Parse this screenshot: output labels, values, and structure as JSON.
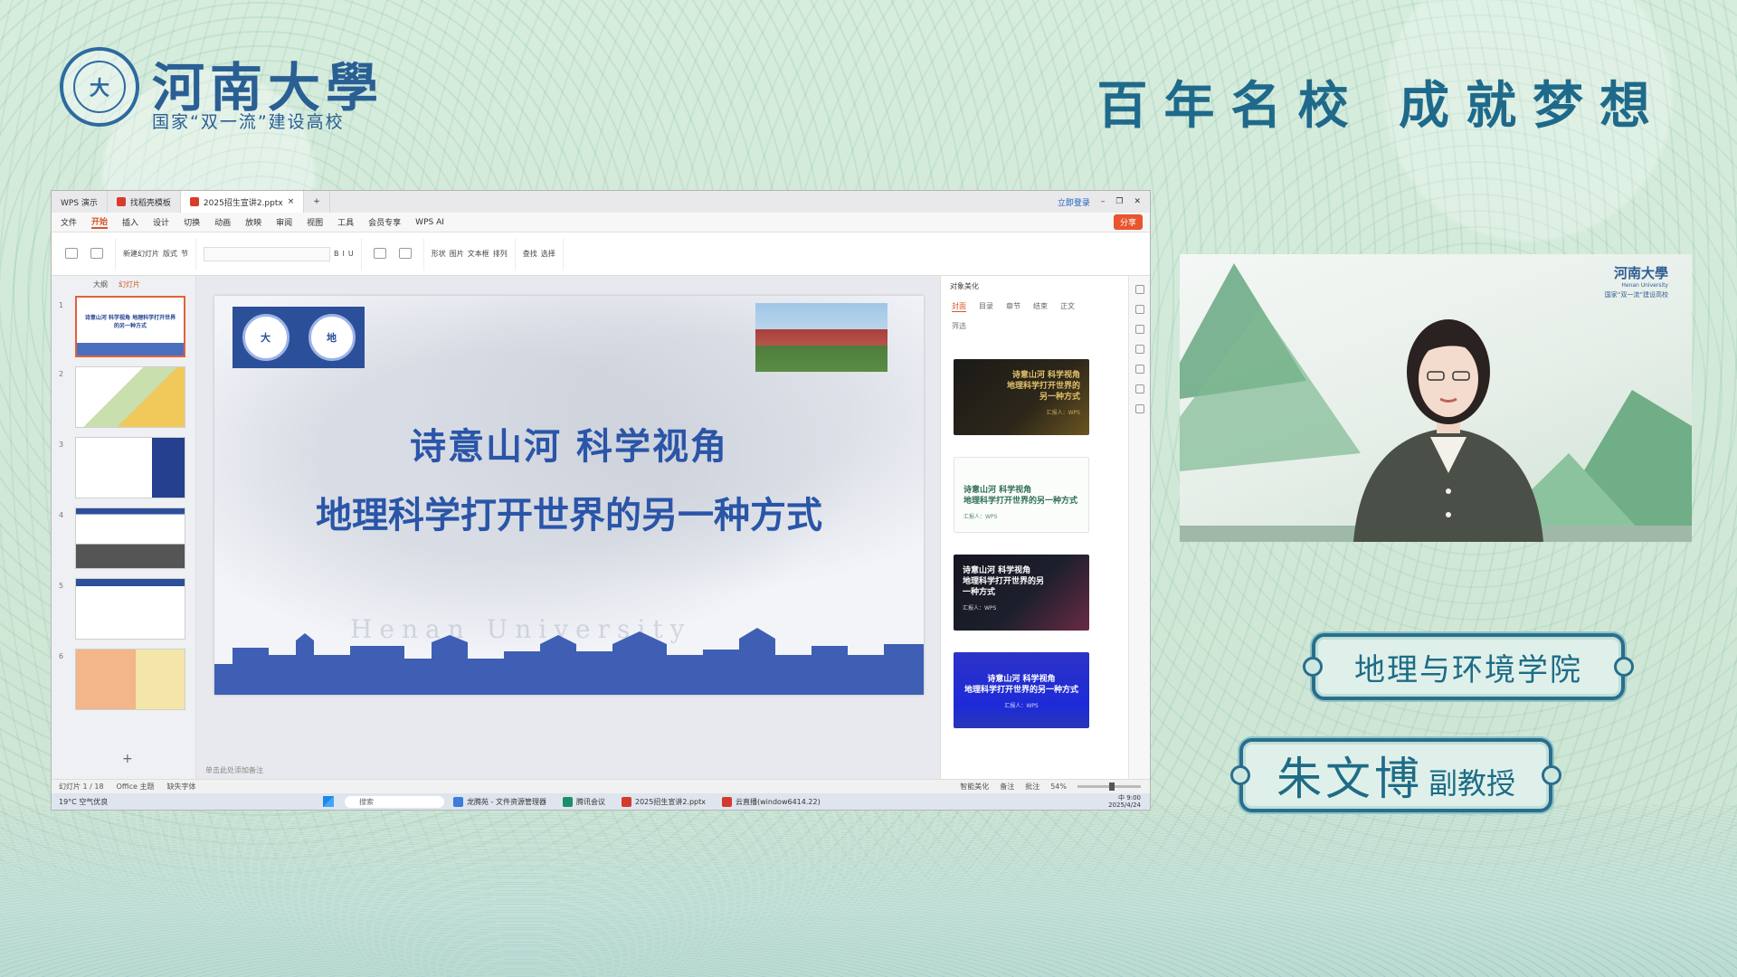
{
  "header": {
    "logo_text": "大",
    "university_name": "河南大學",
    "university_subtitle": "国家“双一流”建设高校",
    "motto": "百年名校 成就梦想"
  },
  "app": {
    "tabs": [
      "WPS 演示",
      "找稻壳模板",
      "2025招生宣讲2.pptx"
    ],
    "login": "立即登录",
    "menu": [
      "文件",
      "开始",
      "插入",
      "设计",
      "切换",
      "动画",
      "放映",
      "审阅",
      "视图",
      "工具",
      "会员专享",
      "WPS AI"
    ],
    "active_menu": "开始",
    "share": "分享",
    "ribbon": {
      "new_slide": "新建幻灯片",
      "layout": "版式",
      "section": "节",
      "find": "查找",
      "select": "选择",
      "shape": "形状",
      "picture": "图片",
      "textbox": "文本框",
      "arrange": "排列"
    },
    "left_tabs": [
      "大纲",
      "幻灯片"
    ],
    "slide_numbers": [
      "1",
      "2",
      "3",
      "4",
      "5",
      "6"
    ],
    "thumb_title": "诗意山河 科学视角 地理科学打开世界的另一种方式",
    "notes_hint": "单击此处添加备注",
    "slide": {
      "logo1": "大",
      "logo2": "地",
      "title_line1": "诗意山河  科学视角",
      "title_line2": "地理科学打开世界的另一种方式",
      "watermark": "Henan University"
    },
    "side_panel": {
      "title": "对象美化",
      "tabs": [
        "封面",
        "目录",
        "章节",
        "结束",
        "正文"
      ],
      "filter": "筛选",
      "templates": [
        {
          "line1": "诗意山河  科学视角",
          "line2": "地理科学打开世界的",
          "line3": "另一种方式",
          "meta": "汇报人：WPS"
        },
        {
          "line1": "诗意山河  科学视角",
          "line2": "地理科学打开世界的另一种方式",
          "meta": "汇报人：WPS"
        },
        {
          "line1": "诗意山河  科学视角",
          "line2": "地理科学打开世界的另",
          "line3": "一种方式",
          "meta": "汇报人：WPS"
        },
        {
          "line1": "诗意山河  科学视角",
          "line2": "地理科学打开世界的另一种方式",
          "meta": "汇报人：WPS"
        }
      ]
    },
    "status": {
      "slide_pos": "幻灯片 1 / 18",
      "theme": "Office 主题",
      "missing_font": "缺失字体",
      "smart_beautify": "智能美化",
      "notes": "备注",
      "comments": "批注",
      "zoom": "54%",
      "zoom_fraction": 0.54
    },
    "taskbar": {
      "weather_temp": "19°C",
      "weather_desc": "空气优良",
      "search": "搜索",
      "apps": [
        "龙腾苑 - 文件资源管理器",
        "腾讯会议",
        "2025招生宣讲2.pptx",
        "云直播(window6414.22)"
      ],
      "time": "9:00",
      "date": "2025/4/24",
      "ime": "中"
    }
  },
  "camera": {
    "logo_name": "河南大學",
    "logo_en": "Henan University",
    "logo_sub": "国家“双一流”建设高校"
  },
  "plates": {
    "department": "地理与环境学院",
    "person_name": "朱文博",
    "person_title": "副教授"
  },
  "colors": {
    "background": "#cfe6d6",
    "brand_blue": "#2a5f94",
    "plate_border": "#2a6e8e",
    "wps_accent": "#d4572a"
  }
}
